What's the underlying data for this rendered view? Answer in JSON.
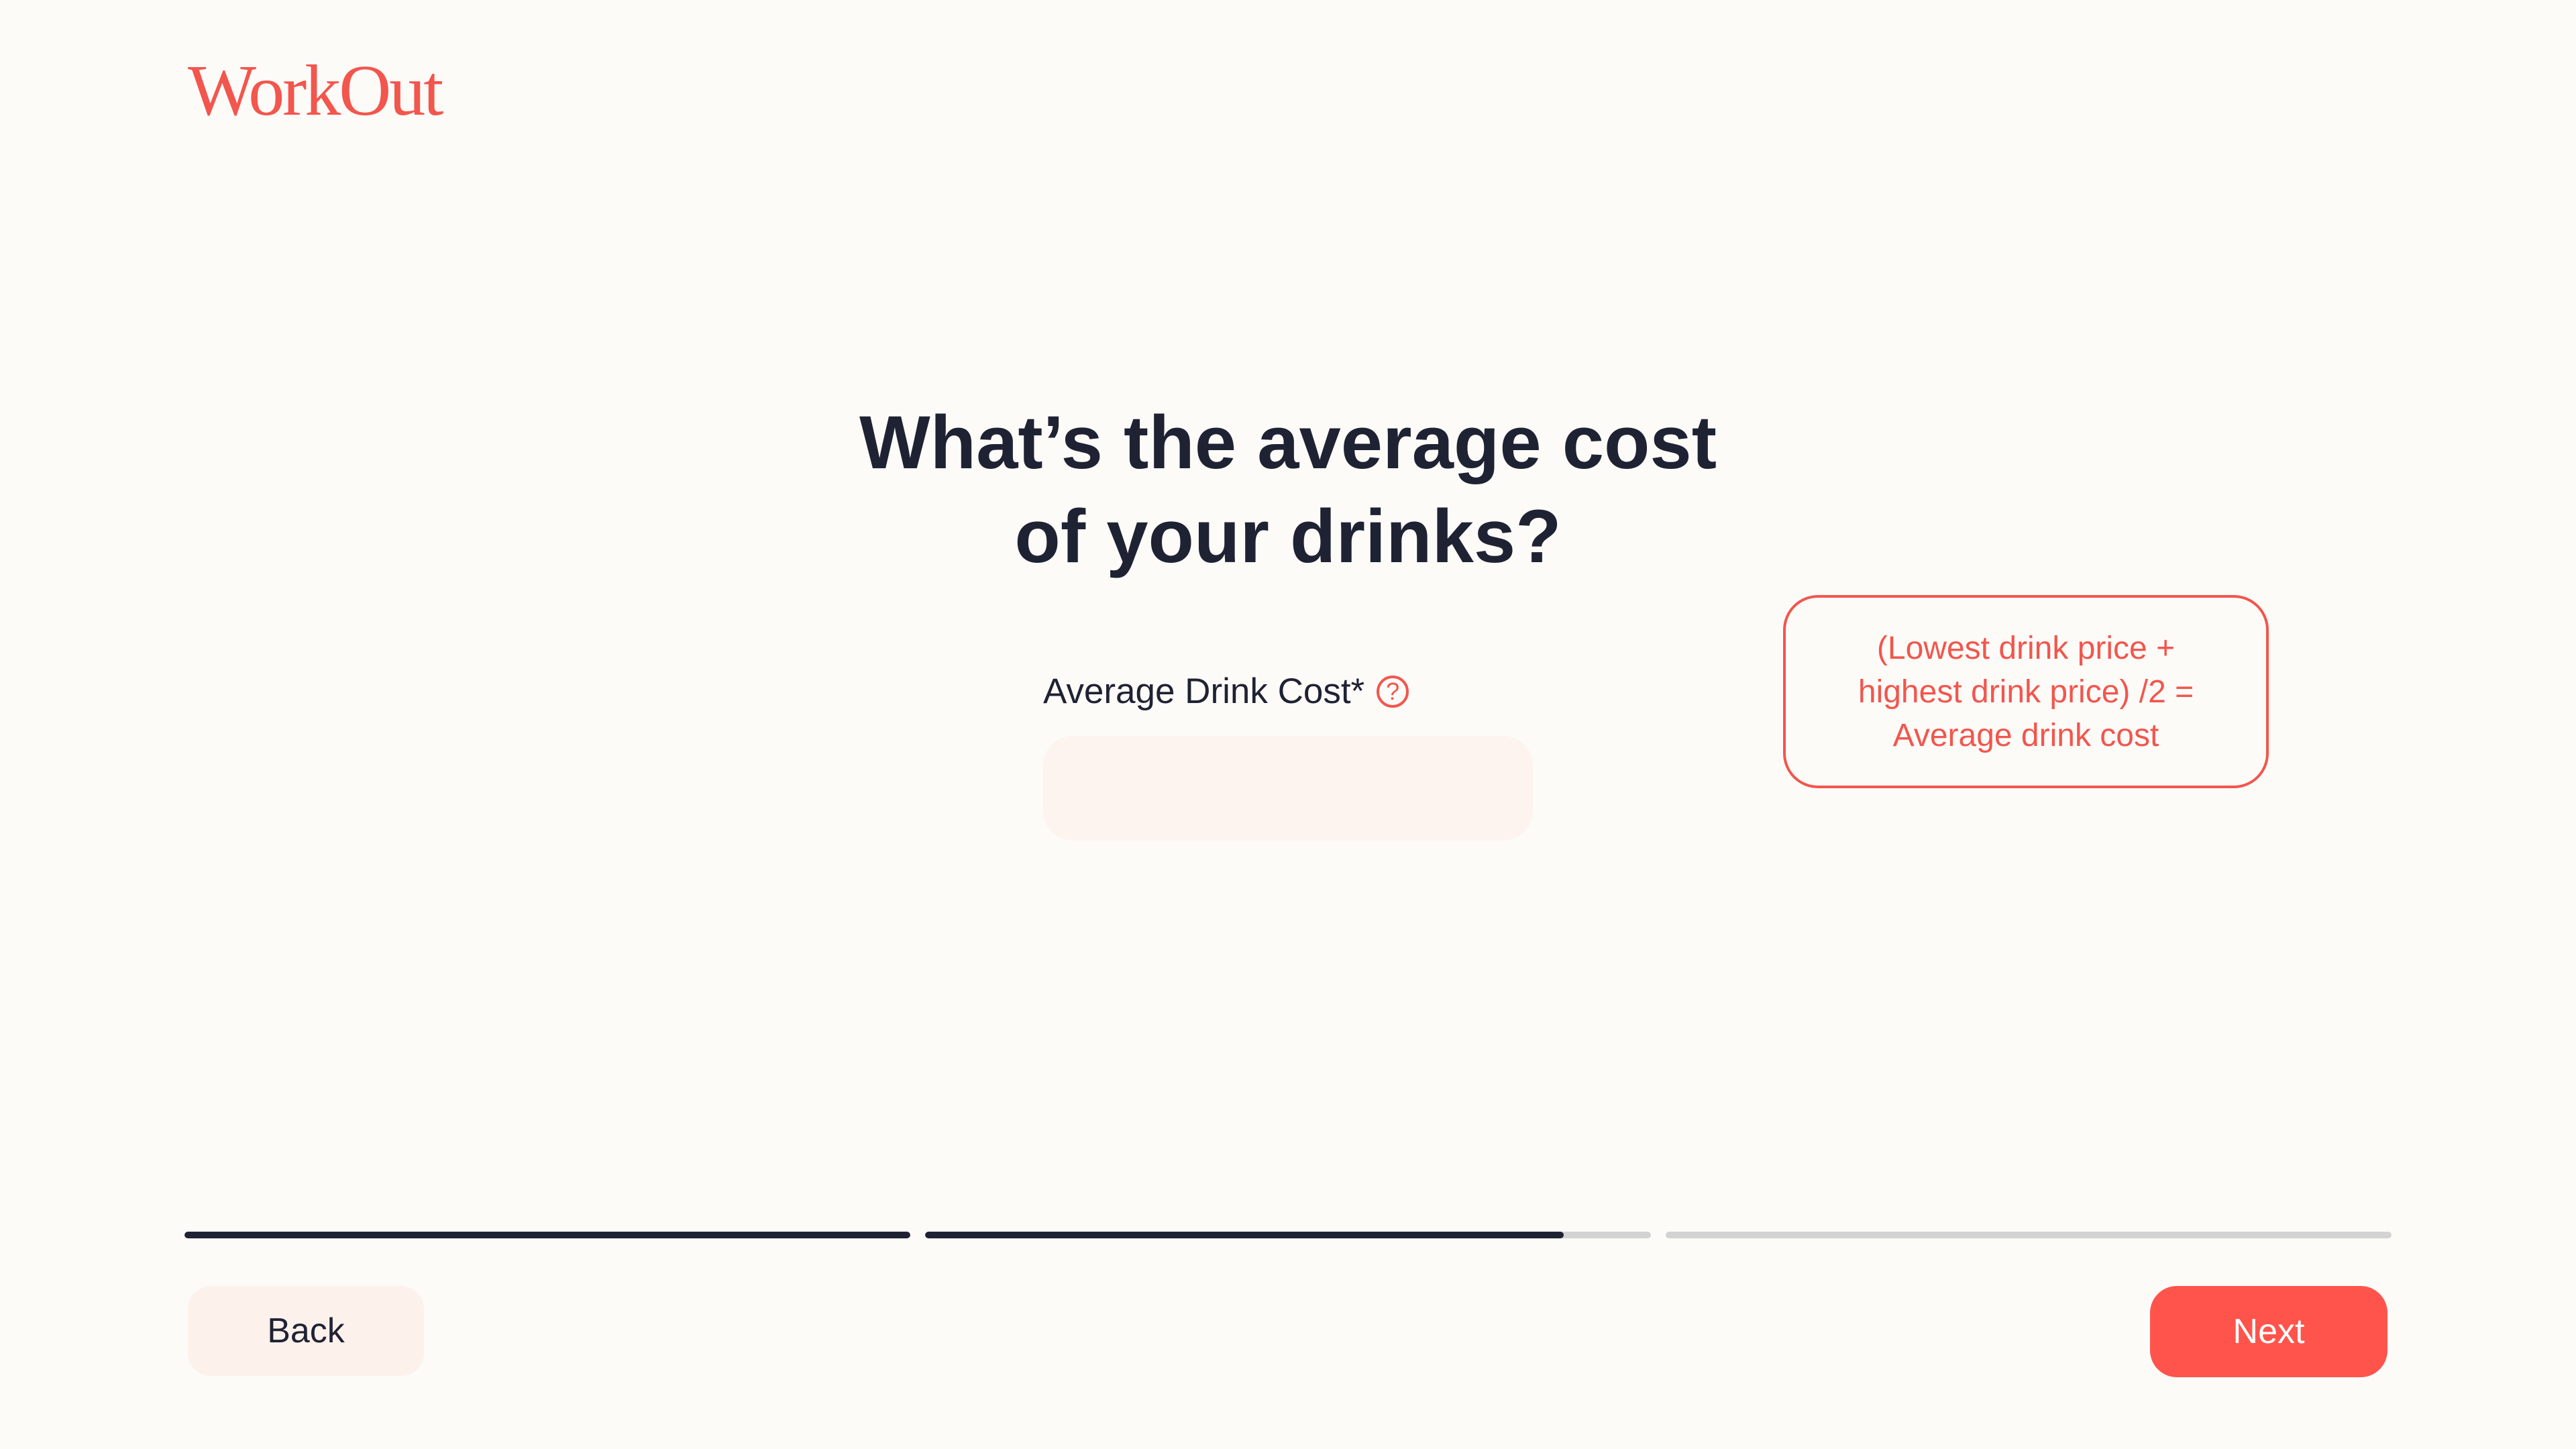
{
  "brand": {
    "logo_text": "WorkOut",
    "accent_color": "#f2564d"
  },
  "question": {
    "line1": "What’s the average cost",
    "line2": "of your drinks?"
  },
  "field": {
    "label": "Average Drink Cost*",
    "help_icon": "question-circle-icon",
    "value": "",
    "placeholder": ""
  },
  "tooltip": {
    "line1": "(Lowest drink price +",
    "line2": "highest drink price) /2 =",
    "line3": "Average drink cost"
  },
  "progress": {
    "segments": [
      {
        "fraction": 1.0
      },
      {
        "fraction": 0.88
      },
      {
        "fraction": 0.0
      }
    ]
  },
  "nav": {
    "back_label": "Back",
    "next_label": "Next"
  }
}
